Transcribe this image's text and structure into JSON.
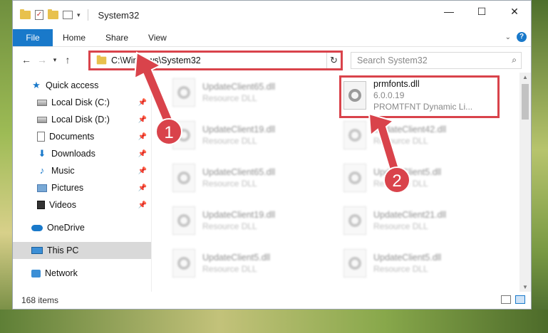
{
  "window": {
    "title": "System32",
    "controls": {
      "minimize": "—",
      "maximize": "☐",
      "close": "✕"
    }
  },
  "ribbon": {
    "tabs": [
      "File",
      "Home",
      "Share",
      "View"
    ],
    "help": "?"
  },
  "address": {
    "path": "C:\\Windows\\System32",
    "refresh": "↻"
  },
  "search": {
    "placeholder": "Search System32",
    "icon": "search-icon"
  },
  "sidebar": {
    "items": [
      {
        "label": "Quick access",
        "icon": "star-icon",
        "pinned": false
      },
      {
        "label": "Local Disk (C:)",
        "icon": "disk-icon",
        "pinned": true
      },
      {
        "label": "Local Disk (D:)",
        "icon": "disk-icon",
        "pinned": true
      },
      {
        "label": "Documents",
        "icon": "documents-icon",
        "pinned": true
      },
      {
        "label": "Downloads",
        "icon": "downloads-icon",
        "pinned": true
      },
      {
        "label": "Music",
        "icon": "music-icon",
        "pinned": true
      },
      {
        "label": "Pictures",
        "icon": "pictures-icon",
        "pinned": true
      },
      {
        "label": "Videos",
        "icon": "videos-icon",
        "pinned": true
      },
      {
        "label": "OneDrive",
        "icon": "onedrive-icon",
        "pinned": false
      },
      {
        "label": "This PC",
        "icon": "pc-icon",
        "pinned": false,
        "selected": true
      },
      {
        "label": "Network",
        "icon": "network-icon",
        "pinned": false
      }
    ]
  },
  "files": {
    "left": [
      {
        "name": "UpdateClient65.dll",
        "type": "Resource DLL"
      },
      {
        "name": "UpdateClient19.dll",
        "type": "Resource DLL"
      },
      {
        "name": "UpdateClient65.dll",
        "type": "Resource DLL"
      },
      {
        "name": "UpdateClient19.dll",
        "type": "Resource DLL"
      },
      {
        "name": "UpdateClient5.dll",
        "type": "Resource DLL"
      }
    ],
    "right": [
      {
        "name": "prmfonts.dll",
        "version": "6.0.0.19",
        "type": "PROMTFNT Dynamic Li..."
      },
      {
        "name": "UpdateClient42.dll",
        "type": "Resource DLL"
      },
      {
        "name": "UpdateClient5.dll",
        "type": "Resource DLL"
      },
      {
        "name": "UpdateClient21.dll",
        "type": "Resource DLL"
      },
      {
        "name": "UpdateClient5.dll",
        "type": "Resource DLL"
      }
    ]
  },
  "status": {
    "count": "168 items"
  },
  "annotations": {
    "step1": "1",
    "step2": "2",
    "accent": "#d9434b"
  }
}
